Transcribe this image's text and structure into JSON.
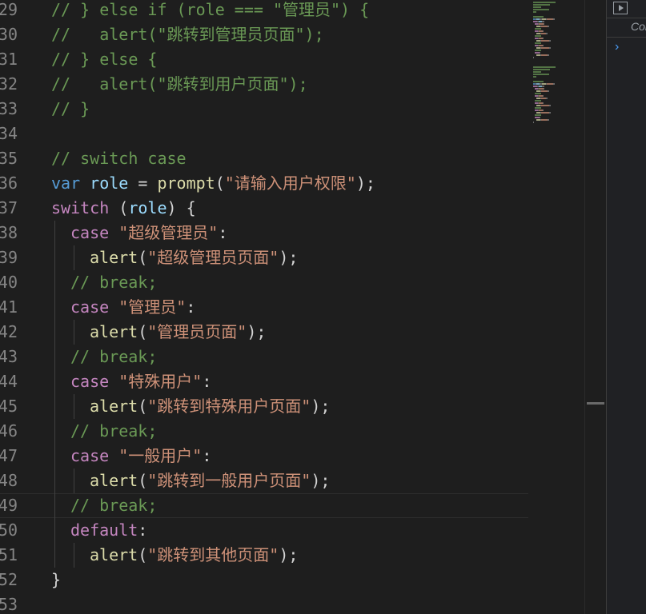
{
  "editor": {
    "lines": [
      {
        "n": "29",
        "tokens": [
          {
            "t": "// } else if (role === \"管理员\") {",
            "c": "c"
          }
        ]
      },
      {
        "n": "30",
        "tokens": [
          {
            "t": "//   alert(\"跳转到管理员页面\");",
            "c": "c"
          }
        ]
      },
      {
        "n": "31",
        "tokens": [
          {
            "t": "// } else {",
            "c": "c"
          }
        ]
      },
      {
        "n": "32",
        "tokens": [
          {
            "t": "//   alert(\"跳转到用户页面\");",
            "c": "c"
          }
        ]
      },
      {
        "n": "33",
        "tokens": [
          {
            "t": "// }",
            "c": "c"
          }
        ]
      },
      {
        "n": "34",
        "tokens": []
      },
      {
        "n": "35",
        "tokens": [
          {
            "t": "// switch case",
            "c": "c"
          }
        ]
      },
      {
        "n": "36",
        "tokens": [
          {
            "t": "var",
            "c": "kv"
          },
          {
            "t": " ",
            "c": "p"
          },
          {
            "t": "role",
            "c": "v"
          },
          {
            "t": " = ",
            "c": "p"
          },
          {
            "t": "prompt",
            "c": "f"
          },
          {
            "t": "(",
            "c": "p"
          },
          {
            "t": "\"请输入用户权限\"",
            "c": "s"
          },
          {
            "t": ");",
            "c": "p"
          }
        ]
      },
      {
        "n": "37",
        "tokens": [
          {
            "t": "switch",
            "c": "k"
          },
          {
            "t": " (",
            "c": "p"
          },
          {
            "t": "role",
            "c": "v"
          },
          {
            "t": ") {",
            "c": "p"
          }
        ]
      },
      {
        "n": "38",
        "indent": 1,
        "tokens": [
          {
            "t": "case",
            "c": "k"
          },
          {
            "t": " ",
            "c": "p"
          },
          {
            "t": "\"超级管理员\"",
            "c": "s"
          },
          {
            "t": ":",
            "c": "p"
          }
        ]
      },
      {
        "n": "39",
        "indent": 2,
        "tokens": [
          {
            "t": "alert",
            "c": "f"
          },
          {
            "t": "(",
            "c": "p"
          },
          {
            "t": "\"超级管理员页面\"",
            "c": "s"
          },
          {
            "t": ");",
            "c": "p"
          }
        ]
      },
      {
        "n": "40",
        "indent": 1,
        "tokens": [
          {
            "t": "// break;",
            "c": "c"
          }
        ]
      },
      {
        "n": "41",
        "indent": 1,
        "tokens": [
          {
            "t": "case",
            "c": "k"
          },
          {
            "t": " ",
            "c": "p"
          },
          {
            "t": "\"管理员\"",
            "c": "s"
          },
          {
            "t": ":",
            "c": "p"
          }
        ]
      },
      {
        "n": "42",
        "indent": 2,
        "tokens": [
          {
            "t": "alert",
            "c": "f"
          },
          {
            "t": "(",
            "c": "p"
          },
          {
            "t": "\"管理员页面\"",
            "c": "s"
          },
          {
            "t": ");",
            "c": "p"
          }
        ]
      },
      {
        "n": "43",
        "indent": 1,
        "tokens": [
          {
            "t": "// break;",
            "c": "c"
          }
        ]
      },
      {
        "n": "44",
        "indent": 1,
        "tokens": [
          {
            "t": "case",
            "c": "k"
          },
          {
            "t": " ",
            "c": "p"
          },
          {
            "t": "\"特殊用户\"",
            "c": "s"
          },
          {
            "t": ":",
            "c": "p"
          }
        ]
      },
      {
        "n": "45",
        "indent": 2,
        "tokens": [
          {
            "t": "alert",
            "c": "f"
          },
          {
            "t": "(",
            "c": "p"
          },
          {
            "t": "\"跳转到特殊用户页面\"",
            "c": "s"
          },
          {
            "t": ");",
            "c": "p"
          }
        ]
      },
      {
        "n": "46",
        "indent": 1,
        "tokens": [
          {
            "t": "// break;",
            "c": "c"
          }
        ]
      },
      {
        "n": "47",
        "indent": 1,
        "tokens": [
          {
            "t": "case",
            "c": "k"
          },
          {
            "t": " ",
            "c": "p"
          },
          {
            "t": "\"一般用户\"",
            "c": "s"
          },
          {
            "t": ":",
            "c": "p"
          }
        ]
      },
      {
        "n": "48",
        "indent": 2,
        "tokens": [
          {
            "t": "alert",
            "c": "f"
          },
          {
            "t": "(",
            "c": "p"
          },
          {
            "t": "\"跳转到一般用户页面\"",
            "c": "s"
          },
          {
            "t": ");",
            "c": "p"
          }
        ]
      },
      {
        "n": "49",
        "indent": 1,
        "current": true,
        "tokens": [
          {
            "t": "// break;",
            "c": "c"
          }
        ]
      },
      {
        "n": "50",
        "indent": 1,
        "tokens": [
          {
            "t": "default",
            "c": "k"
          },
          {
            "t": ":",
            "c": "p"
          }
        ]
      },
      {
        "n": "51",
        "indent": 2,
        "tokens": [
          {
            "t": "alert",
            "c": "f"
          },
          {
            "t": "(",
            "c": "p"
          },
          {
            "t": "\"跳转到其他页面\"",
            "c": "s"
          },
          {
            "t": ");",
            "c": "p"
          }
        ]
      },
      {
        "n": "52",
        "tokens": [
          {
            "t": "}",
            "c": "p"
          }
        ]
      },
      {
        "n": "53",
        "tokens": []
      }
    ]
  },
  "devtools": {
    "console_tab": "Console",
    "prompt_glyph": "›"
  },
  "colors": {
    "background": "#1e1e1e",
    "comment": "#6a9955",
    "keyword": "#c586c0",
    "string": "#ce9178",
    "function": "#dcdcaa",
    "variable": "#9cdcfe",
    "line_number": "#858585"
  }
}
